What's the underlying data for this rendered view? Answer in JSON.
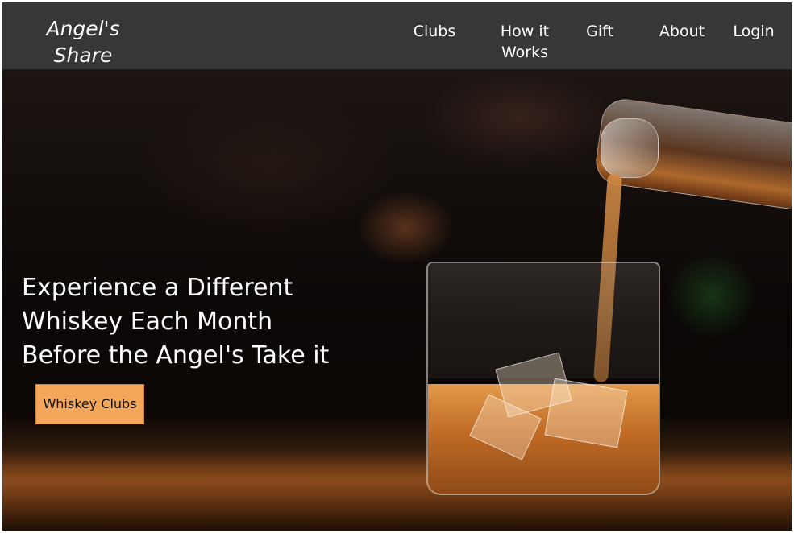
{
  "header": {
    "logo": "Angel's\nShare",
    "nav": {
      "clubs": "Clubs",
      "how_it_works": "How it\nWorks",
      "gift": "Gift",
      "about": "About",
      "login": "Login"
    }
  },
  "hero": {
    "headline": "Experience a Different\nWhiskey Each Month\nBefore the Angel's Take it",
    "cta_label": "Whiskey Clubs",
    "image_subject": "whiskey-pouring-into-glass"
  },
  "colors": {
    "navbar_bg": "#373737",
    "cta_bg": "#f4a65b",
    "text_light": "#ffffff",
    "hero_bg": "#0b0806"
  }
}
